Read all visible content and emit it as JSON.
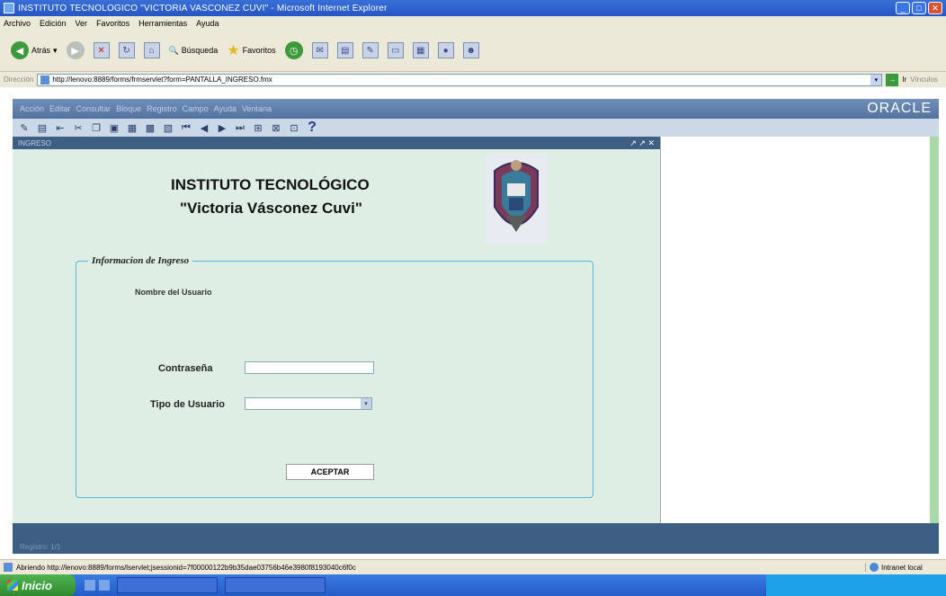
{
  "window": {
    "title": "INSTITUTO TECNOLOGICO \"VICTORIA VASCONEZ CUVI\" - Microsoft Internet Explorer"
  },
  "ie_menu": [
    "Archivo",
    "Edición",
    "Ver",
    "Favoritos",
    "Herramientas",
    "Ayuda"
  ],
  "ie_toolbar": {
    "back_label": "Atrás",
    "search_label": "Búsqueda",
    "favorites_label": "Favoritos"
  },
  "address_bar": {
    "label": "Dirección",
    "url": "http://lenovo:8889/forms/frmservlet?form=PANTALLA_INGRESO.fmx",
    "go_label": "Ir",
    "links_label": "Vínculos"
  },
  "oracle": {
    "menu": [
      "Acción",
      "Editar",
      "Consultar",
      "Bloque",
      "Registro",
      "Campo",
      "Ayuda",
      "Ventana"
    ],
    "logo": "ORACLE",
    "frame_title": "INGRESO",
    "frame_controls": "↗ ↗ ✕",
    "status_text": "Registro: 1/1"
  },
  "form": {
    "institute_title": "INSTITUTO TECNOLÓGICO",
    "institute_name": "\"Victoria Vásconez Cuvi\"",
    "group_legend": "Informacion de Ingreso",
    "username_label": "Nombre del Usuario",
    "password_label": "Contraseña",
    "password_value": "",
    "user_type_label": "Tipo de Usuario",
    "user_type_value": "",
    "accept_label": "ACEPTAR"
  },
  "statusbar": {
    "text": "Abriendo http://lenovo:8889/forms/lservlet;jsessionid=7f00000122b9b35dae03756b46e3980f8193040c6f0c",
    "zone": "Intranet local"
  },
  "taskbar": {
    "start_label": "Inicio"
  }
}
